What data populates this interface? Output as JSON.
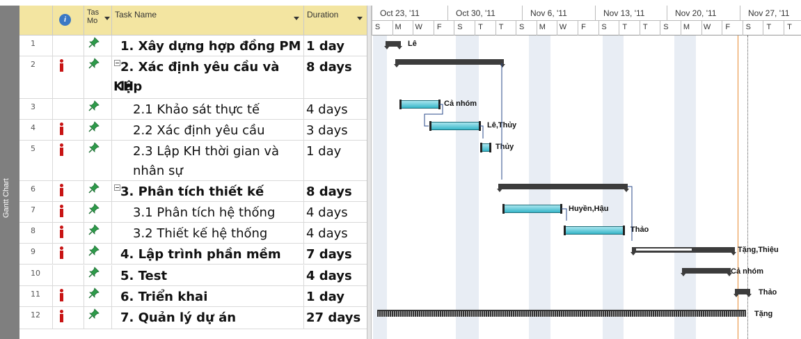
{
  "sidebar": {
    "view_label": "Gantt Chart"
  },
  "header": {
    "info_icon": "i",
    "task_mode_label": "Tas\nMo",
    "task_name_label": "Task Name",
    "duration_label": "Duration"
  },
  "rows": [
    {
      "id": "1",
      "name": "1. Xây dựng hợp đồng PM",
      "duration": "1 day",
      "bold": true,
      "indicator": false,
      "collapse": false
    },
    {
      "id": "2",
      "name": "2. Xác định yêu cầu và lập",
      "name2": "KH",
      "duration": "8 days",
      "bold": true,
      "indicator": true,
      "collapse": true
    },
    {
      "id": "3",
      "name": "2.1 Khảo sát thực tế",
      "duration": "4 days",
      "bold": false,
      "indicator": false,
      "collapse": false
    },
    {
      "id": "4",
      "name": "2.2 Xác định yêu cầu",
      "duration": "3 days",
      "bold": false,
      "indicator": true,
      "collapse": false
    },
    {
      "id": "5",
      "name": "2.3 Lập KH thời gian và",
      "name2": "nhân sự",
      "duration": "1 day",
      "bold": false,
      "indicator": true,
      "collapse": false
    },
    {
      "id": "6",
      "name": "3. Phân tích thiết kế",
      "duration": "8 days",
      "bold": true,
      "indicator": true,
      "collapse": true
    },
    {
      "id": "7",
      "name": "3.1 Phân tích hệ thống",
      "duration": "4 days",
      "bold": false,
      "indicator": true,
      "collapse": false
    },
    {
      "id": "8",
      "name": "3.2 Thiết kế hệ thống",
      "duration": "4 days",
      "bold": false,
      "indicator": true,
      "collapse": false
    },
    {
      "id": "9",
      "name": "4. Lập trình phần mềm",
      "duration": "7 days",
      "bold": true,
      "indicator": true,
      "collapse": false
    },
    {
      "id": "10",
      "name": "5. Test",
      "duration": "4 days",
      "bold": true,
      "indicator": false,
      "collapse": false
    },
    {
      "id": "11",
      "name": "6. Triển khai",
      "duration": "1 day",
      "bold": true,
      "indicator": true,
      "collapse": false
    },
    {
      "id": "12",
      "name": "7. Quản lý dự án",
      "duration": "27 days",
      "bold": true,
      "indicator": true,
      "collapse": false
    }
  ],
  "timescale": {
    "weeks": [
      "Oct 23, '11",
      "Oct 30, '11",
      "Nov 6, '11",
      "Nov 13, '11",
      "Nov 20, '11",
      "Nov 27, '11"
    ],
    "days": [
      "S",
      "M",
      "W",
      "F",
      "S",
      "T",
      "T",
      "S",
      "M",
      "W",
      "F",
      "S",
      "T",
      "T",
      "S",
      "M",
      "W",
      "F",
      "S",
      "T",
      "T"
    ]
  },
  "resource_labels": [
    "Lê",
    "Cả nhóm",
    "Lê,Thủy",
    "Thủy",
    "Huyền,Hậu",
    "Thảo",
    "Tặng,Thiệu",
    "Cả nhóm",
    "Thảo",
    "Tặng"
  ],
  "colors": {
    "header_bg": "#f3e5a1",
    "task_bar": "#36b6c8",
    "summary_bar": "#3c3c3c",
    "indicator": "#c81414",
    "pin": "#2e9b4a",
    "today_line": "#e6892f"
  }
}
